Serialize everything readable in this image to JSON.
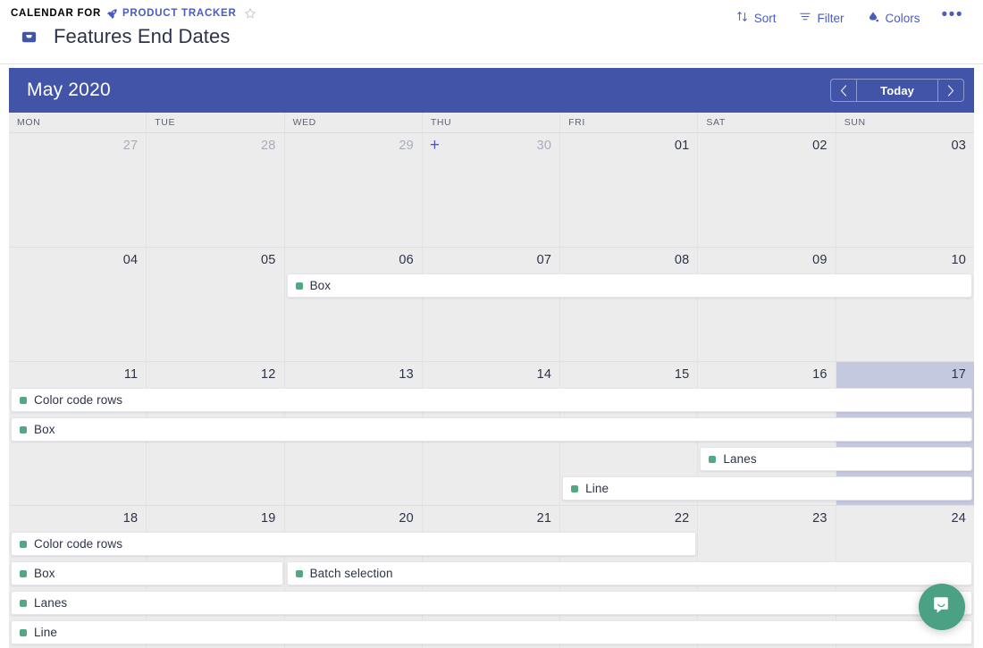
{
  "breadcrumb": {
    "prefix": "CALENDAR FOR",
    "project": "PRODUCT TRACKER",
    "project_icon": "rocket-icon",
    "star_icon": "star-outline-icon"
  },
  "page": {
    "title": "Features End Dates",
    "icon": "inbox-icon"
  },
  "toolbar": {
    "sort_label": "Sort",
    "filter_label": "Filter",
    "colors_label": "Colors",
    "more_label": "•••"
  },
  "calendar": {
    "month_label": "May 2020",
    "today_label": "Today",
    "prev_label": "‹",
    "next_label": "›",
    "header_color": "#4254a8",
    "today_highlight_color": "#c5c9e0",
    "event_dot_color": "#52a884",
    "add_label": "+",
    "weekdays": [
      "MON",
      "TUE",
      "WED",
      "THU",
      "FRI",
      "SAT",
      "SUN"
    ],
    "weeks": [
      {
        "days": [
          {
            "num": "27",
            "muted": true,
            "today": false,
            "add": false
          },
          {
            "num": "28",
            "muted": true,
            "today": false,
            "add": false
          },
          {
            "num": "29",
            "muted": true,
            "today": false,
            "add": false
          },
          {
            "num": "30",
            "muted": true,
            "today": false,
            "add": true
          },
          {
            "num": "01",
            "muted": false,
            "today": false,
            "add": false
          },
          {
            "num": "02",
            "muted": false,
            "today": false,
            "add": false
          },
          {
            "num": "03",
            "muted": false,
            "today": false,
            "add": false
          }
        ],
        "events": []
      },
      {
        "days": [
          {
            "num": "04",
            "muted": false,
            "today": false,
            "add": false
          },
          {
            "num": "05",
            "muted": false,
            "today": false,
            "add": false
          },
          {
            "num": "06",
            "muted": false,
            "today": false,
            "add": false
          },
          {
            "num": "07",
            "muted": false,
            "today": false,
            "add": false
          },
          {
            "num": "08",
            "muted": false,
            "today": false,
            "add": false
          },
          {
            "num": "09",
            "muted": false,
            "today": false,
            "add": false
          },
          {
            "num": "10",
            "muted": false,
            "today": false,
            "add": false
          }
        ],
        "events": [
          {
            "title": "Box",
            "start": 2,
            "span": 5,
            "lane": 0
          }
        ]
      },
      {
        "days": [
          {
            "num": "11",
            "muted": false,
            "today": false,
            "add": false
          },
          {
            "num": "12",
            "muted": false,
            "today": false,
            "add": false
          },
          {
            "num": "13",
            "muted": false,
            "today": false,
            "add": false
          },
          {
            "num": "14",
            "muted": false,
            "today": false,
            "add": false
          },
          {
            "num": "15",
            "muted": false,
            "today": false,
            "add": false
          },
          {
            "num": "16",
            "muted": false,
            "today": false,
            "add": false
          },
          {
            "num": "17",
            "muted": false,
            "today": true,
            "add": false
          }
        ],
        "events": [
          {
            "title": "Color code rows",
            "start": 0,
            "span": 7,
            "lane": 0
          },
          {
            "title": "Box",
            "start": 0,
            "span": 7,
            "lane": 1
          },
          {
            "title": "Lanes",
            "start": 5,
            "span": 2,
            "lane": 2
          },
          {
            "title": "Line",
            "start": 4,
            "span": 3,
            "lane": 3
          }
        ]
      },
      {
        "days": [
          {
            "num": "18",
            "muted": false,
            "today": false,
            "add": false
          },
          {
            "num": "19",
            "muted": false,
            "today": false,
            "add": false
          },
          {
            "num": "20",
            "muted": false,
            "today": false,
            "add": false
          },
          {
            "num": "21",
            "muted": false,
            "today": false,
            "add": false
          },
          {
            "num": "22",
            "muted": false,
            "today": false,
            "add": false
          },
          {
            "num": "23",
            "muted": false,
            "today": false,
            "add": false
          },
          {
            "num": "24",
            "muted": false,
            "today": false,
            "add": false
          }
        ],
        "events": [
          {
            "title": "Color code rows",
            "start": 0,
            "span": 5,
            "lane": 0
          },
          {
            "title": "Box",
            "start": 0,
            "span": 2,
            "lane": 1
          },
          {
            "title": "Batch selection",
            "start": 2,
            "span": 5,
            "lane": 1
          },
          {
            "title": "Lanes",
            "start": 0,
            "span": 7,
            "lane": 2
          },
          {
            "title": "Line",
            "start": 0,
            "span": 7,
            "lane": 3
          }
        ]
      }
    ]
  },
  "chat": {
    "icon": "chat-bubble-icon",
    "color": "#4aa183"
  }
}
